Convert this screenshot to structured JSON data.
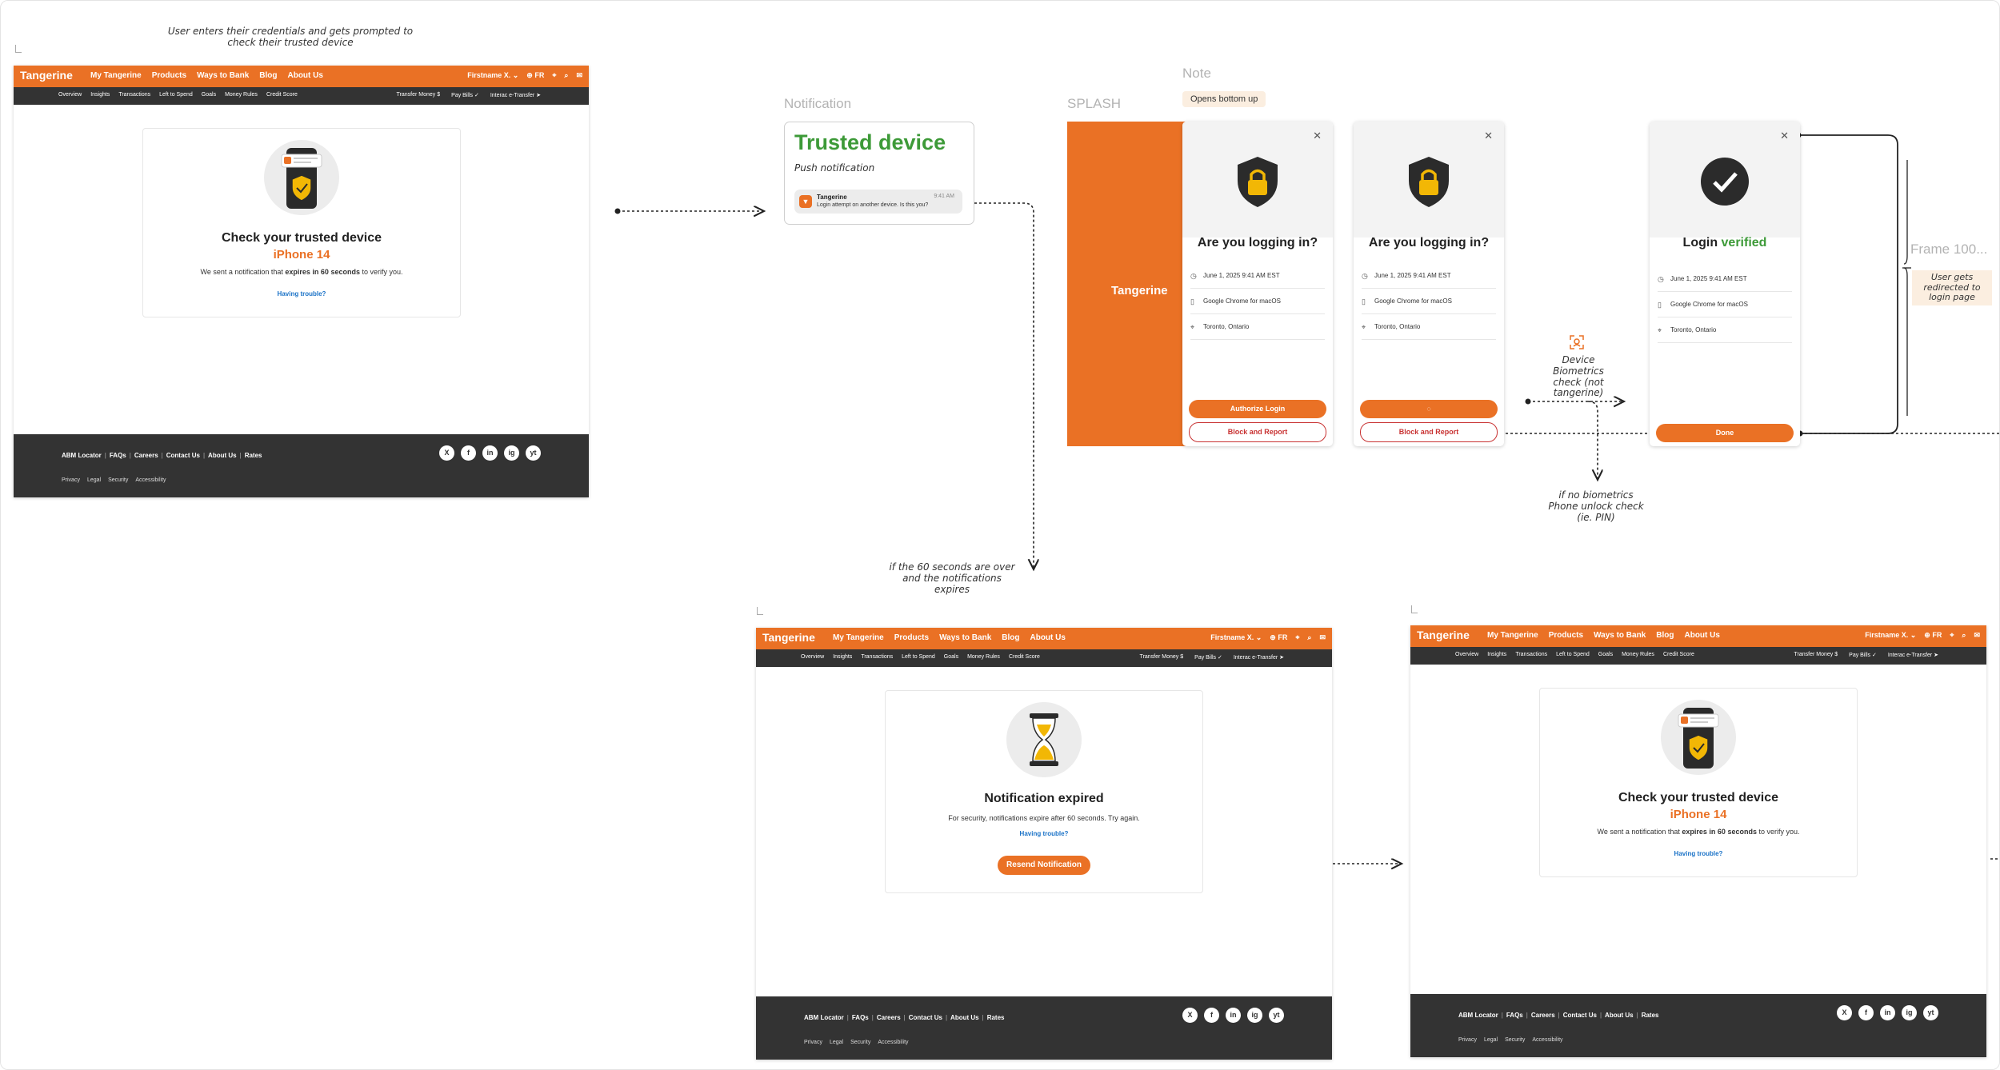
{
  "annotations": {
    "intro": "User enters their credentials and gets prompted to check their trusted device",
    "expired_condition": "if the 60 seconds are over and the notifications expires",
    "biometrics": "Device Biometrics check (not tangerine)",
    "no_biometrics": "if no biometrics Phone unlock check (ie. PIN)",
    "redirect": "User gets redirected to login page"
  },
  "frame_labels": {
    "notification": "Notification",
    "splash": "SPLASH",
    "note": "Note",
    "frame100": "Frame 100..."
  },
  "note_tag": "Opens bottom up",
  "web": {
    "logo": "Tangerine",
    "nav": [
      "My Tangerine",
      "Products",
      "Ways to Bank",
      "Blog",
      "About Us"
    ],
    "user": "Firstname X.",
    "lang": "FR",
    "subnav": [
      "Overview",
      "Insights",
      "Transactions",
      "Left to Spend",
      "Goals",
      "Money Rules",
      "Credit Score"
    ],
    "subnav_right": [
      "Transfer Money",
      "Pay Bills",
      "Interac e-Transfer"
    ],
    "footer_links": [
      "ABM Locator",
      "FAQs",
      "Careers",
      "Contact Us",
      "About Us",
      "Rates"
    ],
    "footer_legal": [
      "Privacy",
      "Legal",
      "Security",
      "Accessibility"
    ],
    "social": [
      "X",
      "f",
      "in",
      "ig",
      "yt"
    ]
  },
  "trusted": {
    "title": "Check your trusted device",
    "device": "iPhone 14",
    "message_pre": "We sent a notification that ",
    "message_bold": "expires in 60 seconds",
    "message_post": " to verify you.",
    "link": "Having trouble?"
  },
  "expired": {
    "title": "Notification expired",
    "message": "For security, notifications expire after 60 seconds. Try again.",
    "link": "Having trouble?",
    "button": "Resend Notification"
  },
  "notification": {
    "heading": "Trusted device",
    "subheading": "Push notification",
    "app": "Tangerine",
    "time": "9:41 AM",
    "body": "Login attempt on another device. Is this you?"
  },
  "splash": {
    "logo": "Tangerine"
  },
  "login_prompt": {
    "title": "Are you logging in?",
    "date": "June 1, 2025 9:41 AM EST",
    "browser": "Google Chrome for macOS",
    "location": "Toronto, Ontario",
    "authorize": "Authorize Login",
    "block": "Block and Report"
  },
  "verified": {
    "title_pre": "Login ",
    "title_accent": "verified",
    "date": "June 1, 2025 9:41 AM EST",
    "browser": "Google Chrome for macOS",
    "location": "Toronto, Ontario",
    "done": "Done"
  },
  "colors": {
    "brand": "#ea7125",
    "dark": "#333333",
    "success": "#3d9a38",
    "link": "#1a72c7",
    "danger": "#c83232"
  }
}
